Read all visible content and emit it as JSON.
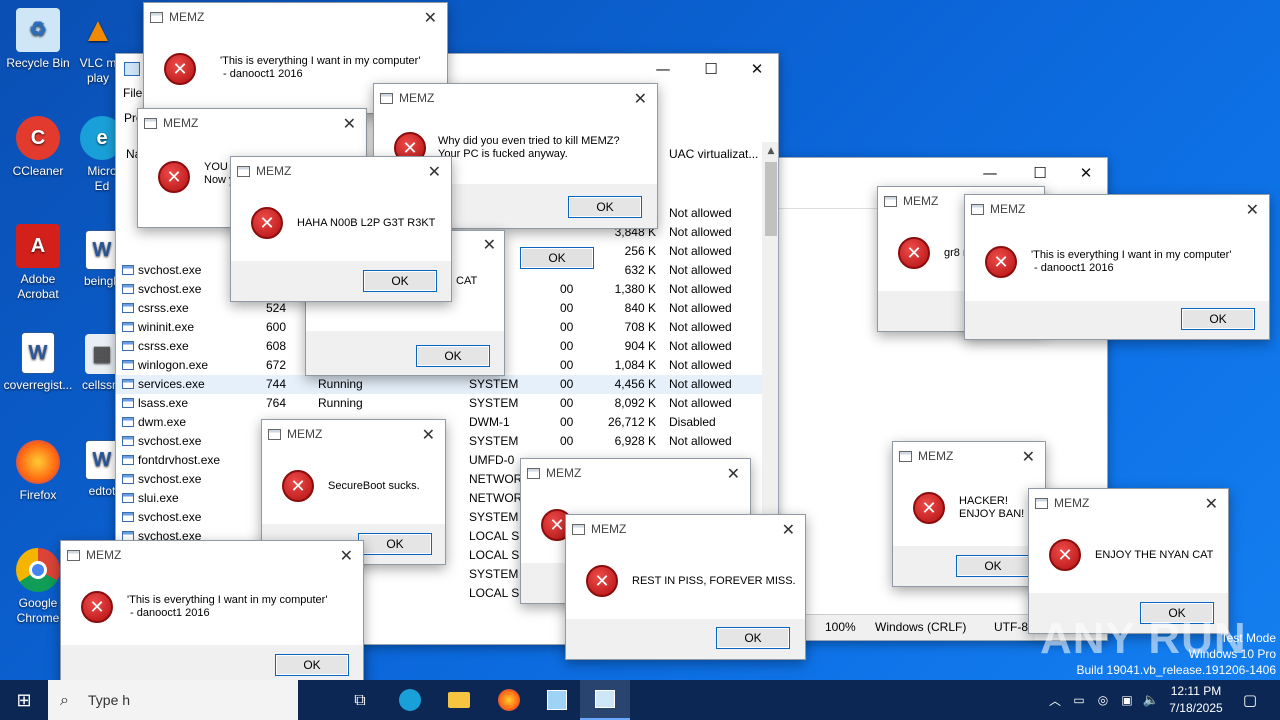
{
  "desktop_icons": [
    {
      "label": "Recycle Bin",
      "icon": "recycle-bin-icon"
    },
    {
      "label": "VLC m\nplay",
      "icon": "vlc-icon"
    },
    {
      "label": "CCleaner",
      "icon": "ccleaner-icon"
    },
    {
      "label": "Micro\nEd",
      "icon": "edge-icon"
    },
    {
      "label": "Adobe\nAcrobat",
      "icon": "acrobat-icon"
    },
    {
      "label": "beingh",
      "icon": "word-doc-icon"
    },
    {
      "label": "coverregist...",
      "icon": "word-doc-icon"
    },
    {
      "label": "cellssm",
      "icon": "image-file-icon"
    },
    {
      "label": "Firefox",
      "icon": "firefox-icon"
    },
    {
      "label": "edtot",
      "icon": "word-doc-icon"
    },
    {
      "label": "Google\nChrome",
      "icon": "chrome-icon"
    }
  ],
  "task_manager": {
    "menu_file": "File",
    "tab_partial": "Pro",
    "col_name_partial": "Na",
    "col_uac": "UAC virtualizat...",
    "rows": [
      {
        "name": "",
        "pid": "",
        "status": "",
        "user": "",
        "cpu": "",
        "mem": "",
        "uac": "Not allowed"
      },
      {
        "name": "",
        "pid": "",
        "status": "",
        "user": "",
        "cpu": "",
        "mem": "3,848 K",
        "uac": "Not allowed"
      },
      {
        "name": "",
        "pid": "",
        "status": "",
        "user": "",
        "cpu": "",
        "mem": "256 K",
        "uac": "Not allowed"
      },
      {
        "name": "svchost.exe",
        "pid": "",
        "status": "",
        "user": "",
        "cpu": "",
        "mem": "632 K",
        "uac": "Not allowed"
      },
      {
        "name": "svchost.exe",
        "pid": "",
        "status": "",
        "user": "M",
        "cpu": "00",
        "mem": "1,380 K",
        "uac": "Not allowed"
      },
      {
        "name": "csrss.exe",
        "pid": "524",
        "status": "",
        "user": "M",
        "cpu": "00",
        "mem": "840 K",
        "uac": "Not allowed"
      },
      {
        "name": "wininit.exe",
        "pid": "600",
        "status": "",
        "user": "M",
        "cpu": "00",
        "mem": "708 K",
        "uac": "Not allowed"
      },
      {
        "name": "csrss.exe",
        "pid": "608",
        "status": "",
        "user": "M",
        "cpu": "00",
        "mem": "904 K",
        "uac": "Not allowed"
      },
      {
        "name": "winlogon.exe",
        "pid": "672",
        "status": "",
        "user": "M",
        "cpu": "00",
        "mem": "1,084 K",
        "uac": "Not allowed"
      },
      {
        "name": "services.exe",
        "pid": "744",
        "status": "Running",
        "user": "SYSTEM",
        "cpu": "00",
        "mem": "4,456 K",
        "uac": "Not allowed"
      },
      {
        "name": "lsass.exe",
        "pid": "764",
        "status": "Running",
        "user": "SYSTEM",
        "cpu": "00",
        "mem": "8,092 K",
        "uac": "Not allowed"
      },
      {
        "name": "dwm.exe",
        "pid": "",
        "status": "",
        "user": "DWM-1",
        "cpu": "00",
        "mem": "26,712 K",
        "uac": "Disabled"
      },
      {
        "name": "svchost.exe",
        "pid": "",
        "status": "",
        "user": "SYSTEM",
        "cpu": "00",
        "mem": "6,928 K",
        "uac": "Not allowed"
      },
      {
        "name": "fontdrvhost.exe",
        "pid": "",
        "status": "",
        "user": "UMFD-0",
        "cpu": "",
        "mem": "",
        "uac": ""
      },
      {
        "name": "svchost.exe",
        "pid": "",
        "status": "",
        "user": "NETWORK",
        "cpu": "",
        "mem": "",
        "uac": ""
      },
      {
        "name": "slui.exe",
        "pid": "",
        "status": "",
        "user": "NETWORK",
        "cpu": "",
        "mem": "",
        "uac": ""
      },
      {
        "name": "svchost.exe",
        "pid": "",
        "status": "",
        "user": "SYSTEM",
        "cpu": "",
        "mem": "",
        "uac": ""
      },
      {
        "name": "svchost.exe",
        "pid": "",
        "status": "",
        "user": "LOCAL SE",
        "cpu": "",
        "mem": "",
        "uac": ""
      },
      {
        "name": "",
        "pid": "",
        "status": "",
        "user": "LOCAL SE",
        "cpu": "",
        "mem": "",
        "uac": ""
      },
      {
        "name": "",
        "pid": "",
        "status": "",
        "user": "SYSTEM",
        "cpu": "",
        "mem": "",
        "uac": ""
      },
      {
        "name": "",
        "pid": "",
        "status": "",
        "user": "LOCAL SE",
        "cpu": "",
        "mem": "",
        "uac": ""
      }
    ]
  },
  "notepad_status": {
    "zoom": "100%",
    "line_ending": "Windows (CRLF)",
    "encoding": "UTF-8"
  },
  "dialogs": [
    {
      "title": "MEMZ",
      "text": "'This is everything I want in my computer'\n - danooct1 2016",
      "ok": ""
    },
    {
      "title": "MEMZ",
      "text": "YOU K\nNow y",
      "ok": ""
    },
    {
      "title": "MEMZ",
      "text": "Why did you even tried to kill MEMZ?\nYour PC is fucked anyway.",
      "ok": "OK"
    },
    {
      "title": "MEMZ",
      "text": "HAHA N00B L2P G3T R3KT",
      "ok": "OK"
    },
    {
      "title": "",
      "text": "CAT",
      "ok": "OK"
    },
    {
      "title": "",
      "text": "",
      "ok": "OK"
    },
    {
      "title": "MEMZ",
      "text": "gr8 m",
      "ok": ""
    },
    {
      "title": "MEMZ",
      "text": "'This is everything I want in my computer'\n - danooct1 2016",
      "ok": "OK"
    },
    {
      "title": "MEMZ",
      "text": "SecureBoot sucks.",
      "ok": "OK"
    },
    {
      "title": "MEMZ",
      "text": "",
      "ok": ""
    },
    {
      "title": "MEMZ",
      "text": "REST IN PISS, FOREVER MISS.",
      "ok": "OK"
    },
    {
      "title": "MEMZ",
      "text": "HACKER!\nENJOY BAN!",
      "ok": "OK"
    },
    {
      "title": "MEMZ",
      "text": "ENJOY THE NYAN CAT",
      "ok": "OK"
    },
    {
      "title": "MEMZ",
      "text": "'This is everything I want in my computer'\n - danooct1 2016",
      "ok": "OK"
    },
    {
      "title": "",
      "text": "",
      "ok": "OK"
    }
  ],
  "watermark": {
    "brand": "ANY RUN",
    "line1": "Test Mode",
    "line2": "Windows 10 Pro",
    "line3": "Build 19041.vb_release.191206-1406"
  },
  "taskbar": {
    "search_placeholder": "Type h",
    "time": "12:11 PM",
    "date": "7/18/2025"
  },
  "colors": {
    "taskbar": "#0c2753",
    "desktop": "#0b64d6",
    "selected_row": "#e5f0fb"
  }
}
